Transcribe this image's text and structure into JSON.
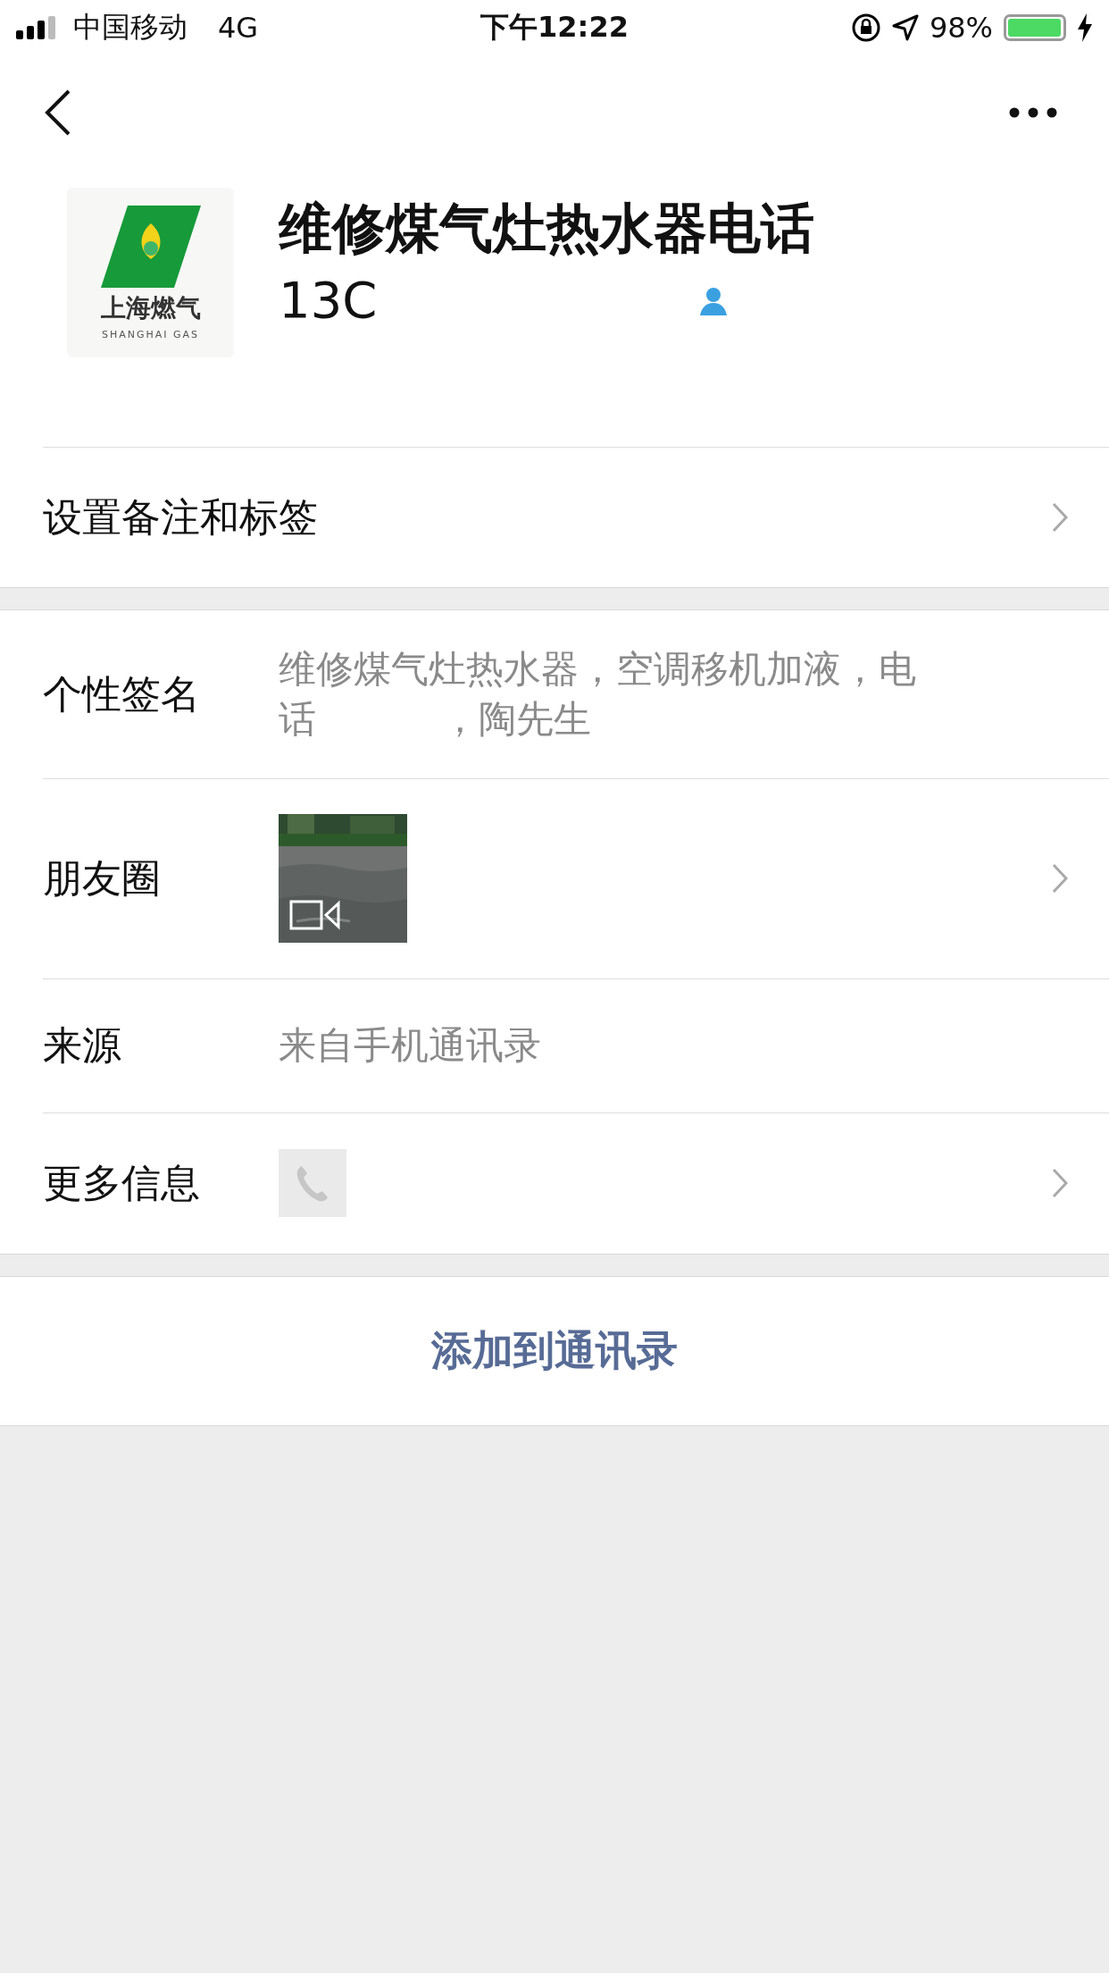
{
  "status_bar": {
    "carrier": "中国移动",
    "network": "4G",
    "time": "下午12:22",
    "battery_text": "98%"
  },
  "profile": {
    "name": "维修煤气灶热水器电话",
    "phone": "13C",
    "avatar_text": "上海燃气",
    "avatar_subtext": "SHANGHAI GAS"
  },
  "remark_row": {
    "label": "设置备注和标签"
  },
  "rows": [
    {
      "kind": "text",
      "label": "个性签名",
      "value": "维修煤气灶热水器，空调移机加液，电话",
      "value_end": "，陶先生",
      "chevron": false
    },
    {
      "kind": "picture",
      "label": "朋友圈",
      "chevron": true
    },
    {
      "kind": "text",
      "label": "来源",
      "value": "来自手机通讯录",
      "chevron": false
    },
    {
      "kind": "phone",
      "label": "更多信息",
      "chevron": true
    }
  ],
  "action": {
    "label": "添加到通讯录"
  }
}
